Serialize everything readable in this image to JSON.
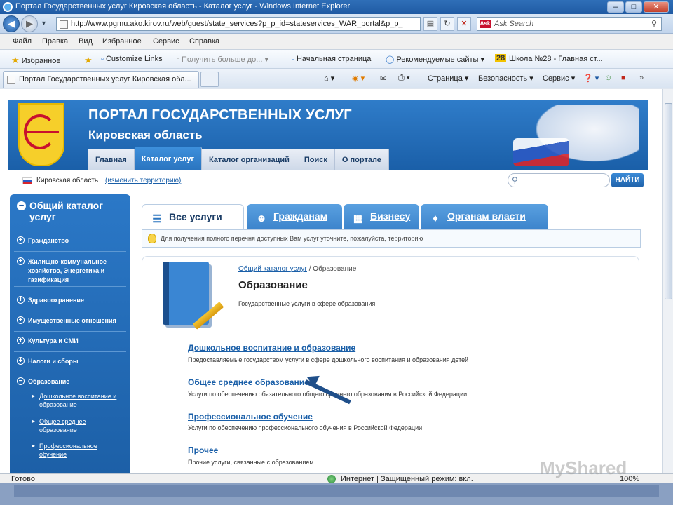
{
  "window": {
    "title": "Портал Государственных услуг Кировская область - Каталог услуг - Windows Internet Explorer"
  },
  "addressbar": {
    "url": "http://www.pgmu.ako.kirov.ru/web/guest/state_services?p_p_id=stateservices_WAR_portal&p_p_",
    "search_placeholder": "Ask Search",
    "search_logo": "Ask"
  },
  "menubar": [
    "Файл",
    "Правка",
    "Вид",
    "Избранное",
    "Сервис",
    "Справка"
  ],
  "favorites": {
    "favorites_label": "Избранное",
    "items": [
      "Customize Links",
      "Получить больше до...",
      "Начальная страница",
      "Рекомендуемые сайты",
      "28",
      "Школа №28 - Главная ст..."
    ]
  },
  "tabbar": {
    "active_tab": "Портал Государственных услуг Кировская обл...",
    "toolbar": [
      "Страница",
      "Безопасность",
      "Сервис"
    ]
  },
  "portal": {
    "title": "ПОРТАЛ ГОСУДАРСТВЕННЫХ УСЛУГ",
    "subtitle": "Кировская область",
    "nav": [
      "Главная",
      "Каталог услуг",
      "Каталог организаций",
      "Поиск",
      "О портале"
    ],
    "region": "Кировская область",
    "change_region": "(изменить территорию)",
    "search_button": "НАЙТИ"
  },
  "sidebar": {
    "heading": "Общий каталог услуг",
    "items": [
      "Гражданство",
      "Жилищно-коммунальное хозяйство, Энергетика и газификация",
      "Здравоохранение",
      "Имущественные отношения",
      "Культура и СМИ",
      "Налоги и сборы",
      "Образование"
    ],
    "subitems": [
      "Дошкольное воспитание и образование",
      "Общее среднее образование",
      "Профессиональное обучение"
    ]
  },
  "content_tabs": [
    "Все услуги",
    "Гражданам",
    "Бизнесу",
    "Органам власти"
  ],
  "hint": "Для получения полного перечня доступных Вам услуг уточните, пожалуйста, территорию",
  "main": {
    "breadcrumb_link": "Общий каталог услуг",
    "breadcrumb_current": " / Образование",
    "title": "Образование",
    "description": "Государственные услуги в сфере образования",
    "services": [
      {
        "title": "Дошкольное воспитание и образование",
        "desc": "Предоставляемые государством услуги в сфере дошкольного воспитания и образования детей"
      },
      {
        "title": "Общее среднее образование",
        "desc": "Услуги по обеспечению обязательного общего среднего образования в Российской Федерации"
      },
      {
        "title": "Профессиональное обучение",
        "desc": "Услуги по обеспечению профессионального обучения в Российской Федерации"
      },
      {
        "title": "Прочее",
        "desc": "Прочие услуги, связанные с образованием"
      }
    ]
  },
  "statusbar": {
    "left": "Готово",
    "zone": "Интернет | Защищенный режим: вкл.",
    "zoom": "100%"
  },
  "watermark": "MyShared"
}
